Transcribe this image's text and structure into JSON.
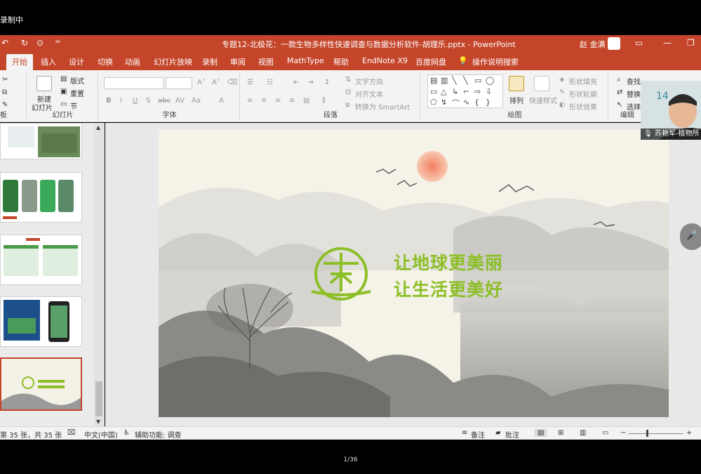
{
  "recording": {
    "label": "录制中"
  },
  "window": {
    "title": "专题12-北极花：一款生物多样性快速调查与数据分析软件-胡理乐.pptx  -  PowerPoint",
    "user": "赵 金满"
  },
  "tabs": [
    "开始",
    "插入",
    "设计",
    "切换",
    "动画",
    "幻灯片放映",
    "录制",
    "审阅",
    "视图",
    "MathType",
    "帮助",
    "EndNote X9",
    "百度网盘",
    "操作说明搜索"
  ],
  "ribbon": {
    "slides_group": {
      "new_slide": "新建",
      "new_slide2": "幻灯片",
      "layout": "版式",
      "reset": "重置",
      "section": "节",
      "label": "幻灯片"
    },
    "font_group": {
      "label": "字体"
    },
    "paragraph_group": {
      "text_direction": "文字方向",
      "align_text": "对齐文本",
      "smartart": "转换为 SmartArt",
      "label": "段落"
    },
    "drawing_group": {
      "arrange": "排列",
      "quick_styles": "快速样式",
      "shape_fill": "形状填充",
      "shape_outline": "形状轮廓",
      "shape_effects": "形状效果",
      "label": "绘图"
    },
    "editing_group": {
      "find": "查找",
      "replace": "替换",
      "select": "选择",
      "label": "编辑"
    },
    "clipboard_label": "板"
  },
  "slide": {
    "line1": "让地球更美丽",
    "line2": "让生活更美好"
  },
  "status": {
    "slide_count": "第 35 张，共 35 张",
    "language": "中文(中国)",
    "accessibility": "辅助功能: 调查",
    "notes": "备注",
    "comments": "批注"
  },
  "webcam": {
    "name": "苏艳军-植物所",
    "badge": "14"
  },
  "pager": "1/36",
  "colors": {
    "accent": "#c4452a",
    "slogan": "#8cbf26"
  }
}
